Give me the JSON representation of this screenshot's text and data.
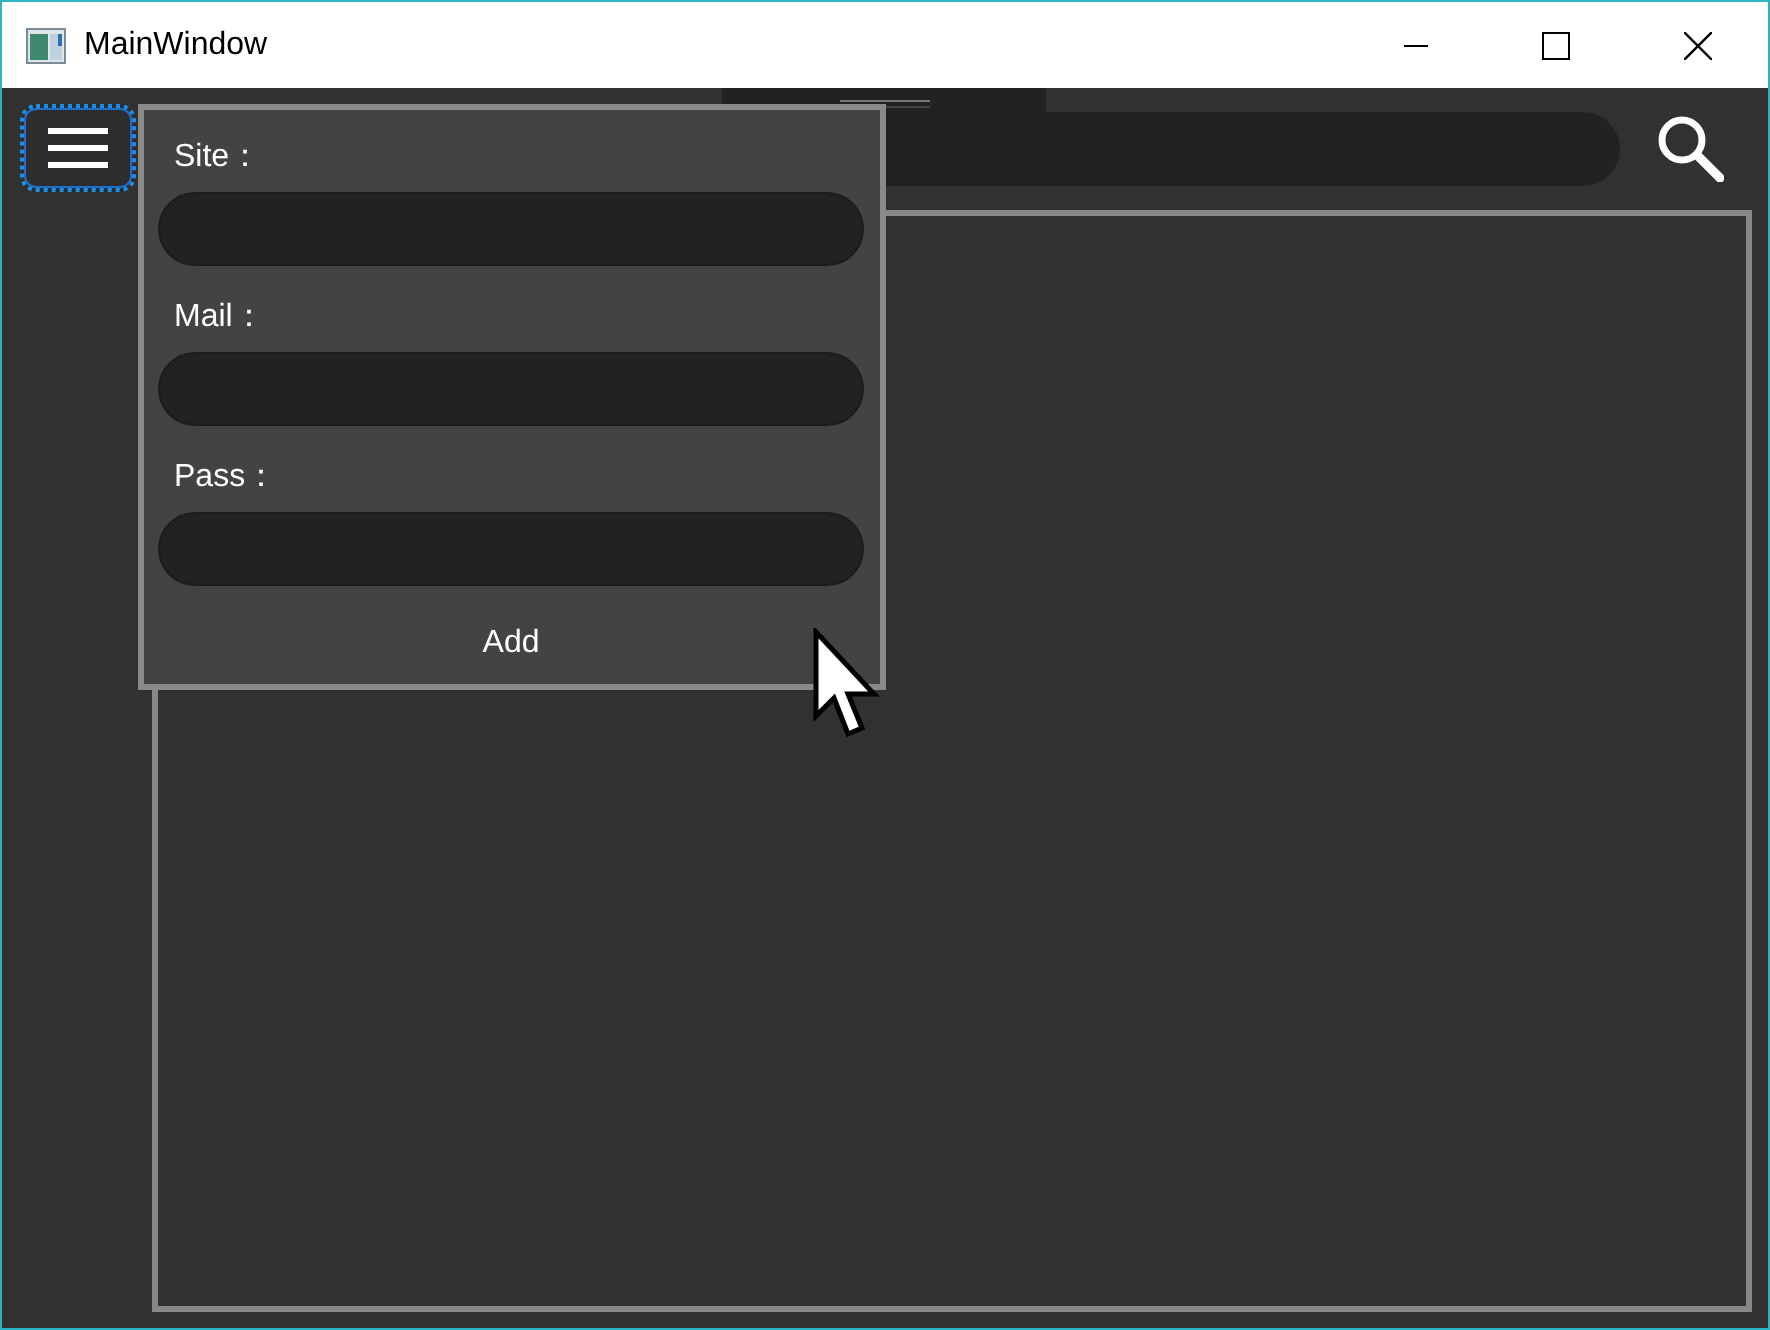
{
  "window": {
    "title": "MainWindow"
  },
  "menu_button": {
    "focused": true
  },
  "popup": {
    "fields": [
      {
        "label": "Site："
      },
      {
        "label": "Mail："
      },
      {
        "label": "Pass："
      }
    ],
    "button": "Add"
  }
}
